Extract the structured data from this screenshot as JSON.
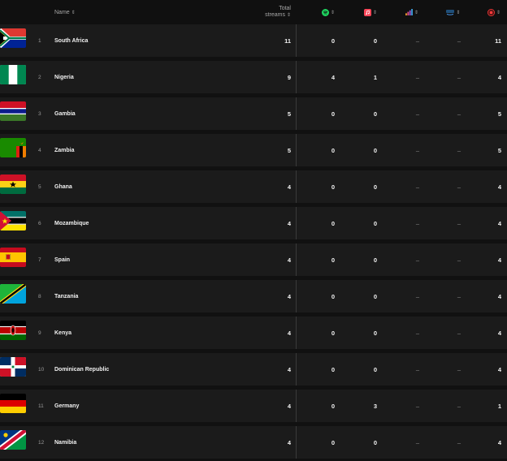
{
  "header": {
    "name_label": "Name",
    "total_label_line1": "Total",
    "total_label_line2": "streams",
    "sort_glyph": "⇕",
    "services": [
      {
        "icon": "spotify-icon",
        "color": "#1ed760"
      },
      {
        "icon": "apple-music-icon",
        "color": "#fa4659"
      },
      {
        "icon": "deezer-icon",
        "color": "#f29d2c"
      },
      {
        "icon": "amazon-music-icon",
        "color": "#4da3ff"
      },
      {
        "icon": "youtube-icon",
        "color": "#ff3b3b"
      }
    ]
  },
  "rows": [
    {
      "rank": "1",
      "country": "South Africa",
      "flag": "za",
      "total": "11",
      "s1": "0",
      "s2": "0",
      "s3": "–",
      "s4": "–",
      "s5": "11"
    },
    {
      "rank": "2",
      "country": "Nigeria",
      "flag": "ng",
      "total": "9",
      "s1": "4",
      "s2": "1",
      "s3": "–",
      "s4": "–",
      "s5": "4"
    },
    {
      "rank": "3",
      "country": "Gambia",
      "flag": "gm",
      "total": "5",
      "s1": "0",
      "s2": "0",
      "s3": "–",
      "s4": "–",
      "s5": "5"
    },
    {
      "rank": "4",
      "country": "Zambia",
      "flag": "zm",
      "total": "5",
      "s1": "0",
      "s2": "0",
      "s3": "–",
      "s4": "–",
      "s5": "5"
    },
    {
      "rank": "5",
      "country": "Ghana",
      "flag": "gh",
      "total": "4",
      "s1": "0",
      "s2": "0",
      "s3": "–",
      "s4": "–",
      "s5": "4"
    },
    {
      "rank": "6",
      "country": "Mozambique",
      "flag": "mz",
      "total": "4",
      "s1": "0",
      "s2": "0",
      "s3": "–",
      "s4": "–",
      "s5": "4"
    },
    {
      "rank": "7",
      "country": "Spain",
      "flag": "es",
      "total": "4",
      "s1": "0",
      "s2": "0",
      "s3": "–",
      "s4": "–",
      "s5": "4"
    },
    {
      "rank": "8",
      "country": "Tanzania",
      "flag": "tz",
      "total": "4",
      "s1": "0",
      "s2": "0",
      "s3": "–",
      "s4": "–",
      "s5": "4"
    },
    {
      "rank": "9",
      "country": "Kenya",
      "flag": "ke",
      "total": "4",
      "s1": "0",
      "s2": "0",
      "s3": "–",
      "s4": "–",
      "s5": "4"
    },
    {
      "rank": "10",
      "country": "Dominican Republic",
      "flag": "do",
      "total": "4",
      "s1": "0",
      "s2": "0",
      "s3": "–",
      "s4": "–",
      "s5": "4"
    },
    {
      "rank": "11",
      "country": "Germany",
      "flag": "de",
      "total": "4",
      "s1": "0",
      "s2": "3",
      "s3": "–",
      "s4": "–",
      "s5": "1"
    },
    {
      "rank": "12",
      "country": "Namibia",
      "flag": "na",
      "total": "4",
      "s1": "0",
      "s2": "0",
      "s3": "–",
      "s4": "–",
      "s5": "4"
    }
  ]
}
